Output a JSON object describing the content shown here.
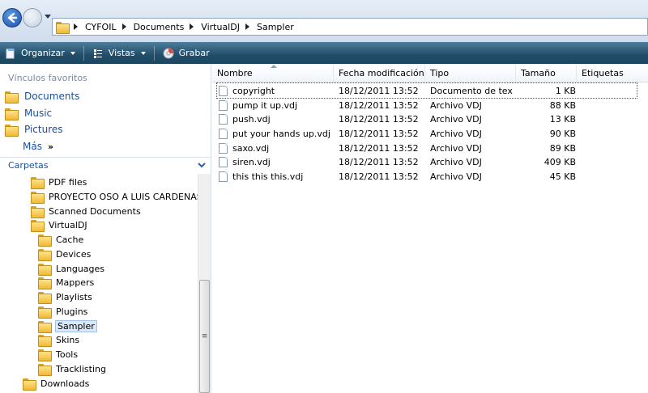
{
  "address": {
    "crumbs": [
      "CYFOIL",
      "Documents",
      "VirtualDJ",
      "Sampler"
    ]
  },
  "toolbar": {
    "organize": "Organizar",
    "views": "Vistas",
    "burn": "Grabar"
  },
  "nav": {
    "favorites_title": "Vínculos favoritos",
    "favorites": [
      {
        "label": "Documents",
        "icon": "folder-icon"
      },
      {
        "label": "Music",
        "icon": "folder-icon"
      },
      {
        "label": "Pictures",
        "icon": "folder-icon"
      }
    ],
    "more": "Más",
    "folders_title": "Carpetas",
    "tree": [
      {
        "label": "PDF files"
      },
      {
        "label": "PROYECTO OSO A LUIS CARDENAS"
      },
      {
        "label": "Scanned Documents"
      },
      {
        "label": "VirtualDJ"
      },
      {
        "label": "Cache"
      },
      {
        "label": "Devices"
      },
      {
        "label": "Languages"
      },
      {
        "label": "Mappers"
      },
      {
        "label": "Playlists"
      },
      {
        "label": "Plugins"
      },
      {
        "label": "Sampler",
        "selected": true
      },
      {
        "label": "Skins"
      },
      {
        "label": "Tools"
      },
      {
        "label": "Tracklisting"
      },
      {
        "label": "Downloads"
      }
    ]
  },
  "list": {
    "columns": [
      "Nombre",
      "Fecha modificación",
      "Tipo",
      "Tamaño",
      "Etiquetas"
    ],
    "rows": [
      {
        "name": "copyright",
        "date": "18/12/2011 13:52",
        "type": "Documento de tex...",
        "size": "1 KB"
      },
      {
        "name": "pump it up.vdj",
        "date": "18/12/2011 13:52",
        "type": "Archivo VDJ",
        "size": "88 KB"
      },
      {
        "name": "push.vdj",
        "date": "18/12/2011 13:52",
        "type": "Archivo VDJ",
        "size": "13 KB"
      },
      {
        "name": "put your hands up.vdj",
        "date": "18/12/2011 13:52",
        "type": "Archivo VDJ",
        "size": "90 KB"
      },
      {
        "name": "saxo.vdj",
        "date": "18/12/2011 13:52",
        "type": "Archivo VDJ",
        "size": "89 KB"
      },
      {
        "name": "siren.vdj",
        "date": "18/12/2011 13:52",
        "type": "Archivo VDJ",
        "size": "409 KB"
      },
      {
        "name": "this this this.vdj",
        "date": "18/12/2011 13:52",
        "type": "Archivo VDJ",
        "size": "45 KB"
      }
    ]
  }
}
